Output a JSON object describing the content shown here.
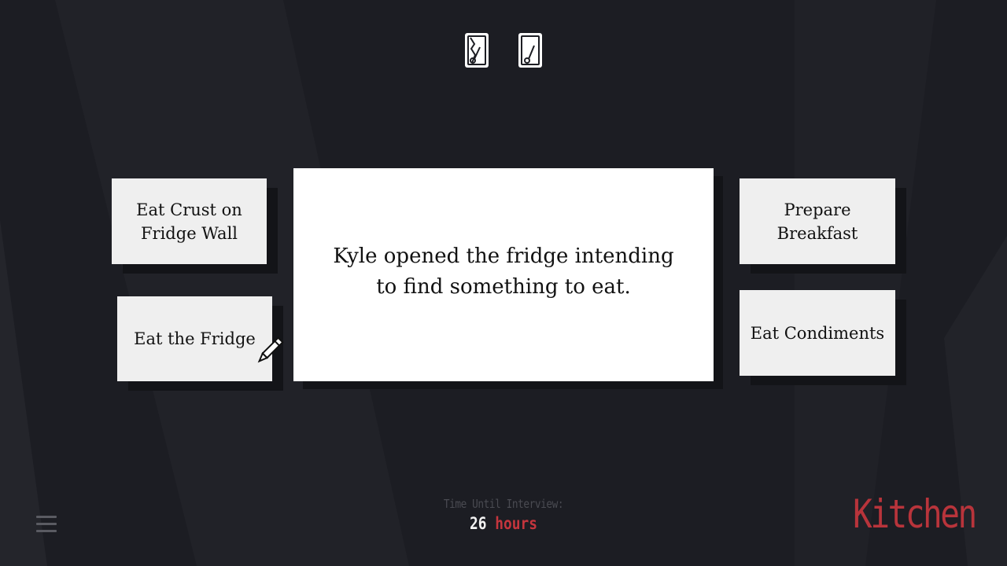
{
  "deck": {
    "icons": [
      "cracked-card-icon",
      "card-icon"
    ]
  },
  "options": {
    "top_left": "Eat Crust on\nFridge Wall",
    "bottom_left": "Eat the Fridge",
    "top_right": "Prepare\nBreakfast",
    "bottom_right": "Eat Condiments"
  },
  "story": {
    "text": "Kyle opened the fridge intending\nto find something to eat."
  },
  "timer": {
    "label": "Time Until Interview:",
    "value": "26",
    "unit": "hours"
  },
  "location": {
    "name": "Kitchen"
  },
  "colors": {
    "background": "#1c1d23",
    "accent_red": "#c4353d",
    "card": "#efefef",
    "story_card": "#ffffff"
  }
}
